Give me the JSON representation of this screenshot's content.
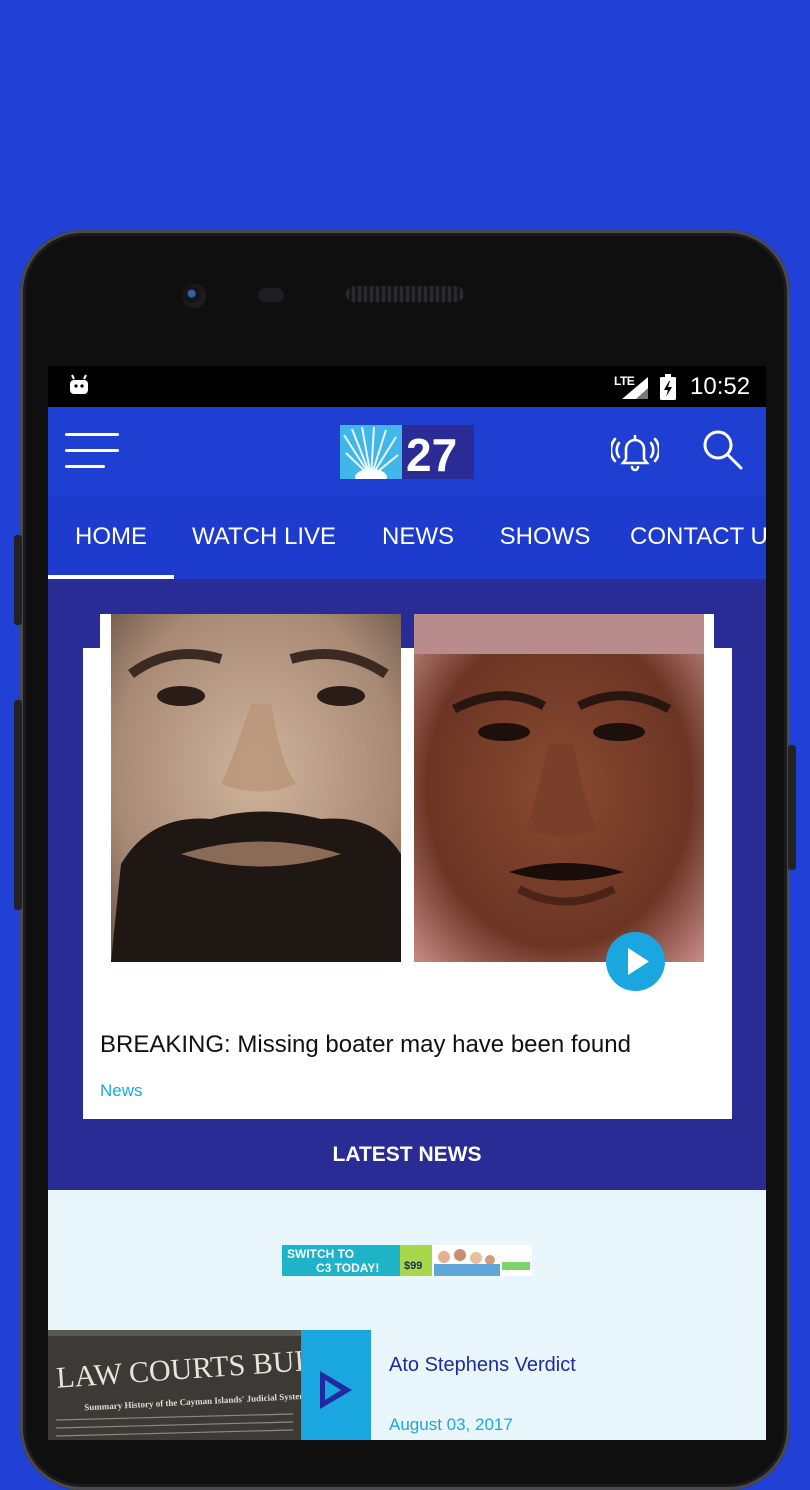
{
  "status_bar": {
    "network": "LTE",
    "time": "10:52"
  },
  "app_bar": {
    "logo_text": "27",
    "icons": [
      "menu-icon",
      "bell-icon",
      "search-icon"
    ]
  },
  "tabs": [
    {
      "label": "HOME",
      "active": true
    },
    {
      "label": "WATCH LIVE",
      "active": false
    },
    {
      "label": "NEWS",
      "active": false
    },
    {
      "label": "SHOWS",
      "active": false
    },
    {
      "label": "CONTACT US",
      "active": false
    }
  ],
  "featured": {
    "headline": "BREAKING: Missing boater may have been found",
    "category": "News"
  },
  "section": {
    "latest_title": "LATEST NEWS"
  },
  "ad": {
    "line1": "SWITCH TO",
    "line2": "C3 TODAY!",
    "price": "$99"
  },
  "news_items": [
    {
      "thumb_title": "LAW COURTS BUILDING",
      "thumb_subtitle": "Summary History of the Cayman Islands' Judicial System",
      "title": "Ato Stephens Verdict",
      "date": "August 03, 2017"
    }
  ],
  "colors": {
    "background": "#2140d6",
    "app_bar": "#1e3fd1",
    "content_bg": "#2a2c96",
    "accent": "#1aa7e0",
    "latest_bg": "#e9f7fd"
  }
}
